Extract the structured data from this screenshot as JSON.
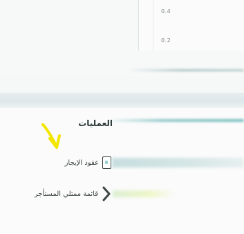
{
  "chart": {
    "y_ticks": [
      "0.4",
      "0.2"
    ]
  },
  "operations": {
    "title": "العمليات",
    "items": [
      {
        "label": "عقود الإيجار",
        "icon": "document-icon"
      },
      {
        "label": "قائمة ممثلي المستأجر",
        "icon": "chevron-icon"
      }
    ]
  },
  "annotation": {
    "arrow_icon": "yellow-arrow-icon",
    "arrow_color": "#f2e600"
  },
  "colors": {
    "accent": "#79bfc1",
    "text": "#2f3a3a"
  }
}
